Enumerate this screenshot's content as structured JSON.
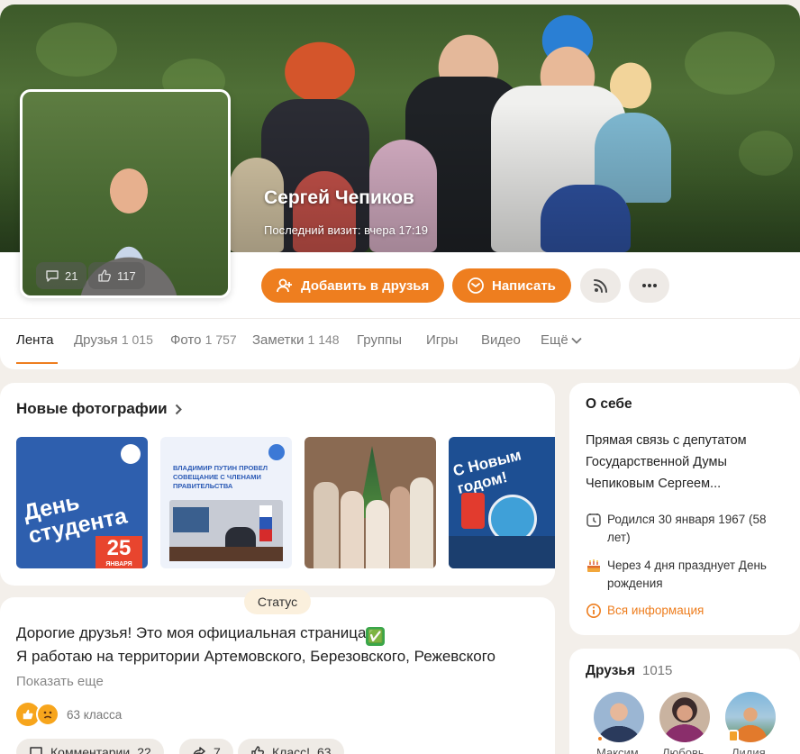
{
  "profile": {
    "name": "Сергей Чепиков",
    "last_visit": "Последний визит: вчера 17:19",
    "avatar_comments": "21",
    "avatar_likes": "117",
    "add_friend_label": "Добавить в друзья",
    "write_label": "Написать"
  },
  "tabs": [
    {
      "label": "Лента",
      "count": ""
    },
    {
      "label": "Друзья",
      "count": "1 015"
    },
    {
      "label": "Фото",
      "count": "1 757"
    },
    {
      "label": "Заметки",
      "count": "1 148"
    },
    {
      "label": "Группы",
      "count": ""
    },
    {
      "label": "Игры",
      "count": ""
    },
    {
      "label": "Видео",
      "count": ""
    },
    {
      "label": "Ещё",
      "count": ""
    }
  ],
  "photos": {
    "title": "Новые фотографии",
    "items": [
      {
        "line1": "День",
        "line2": "студента",
        "num": "25",
        "sub": "ЯНВАРЯ"
      },
      {
        "headline": "ВЛАДИМИР ПУТИН ПРОВЕЛ СОВЕЩАНИЕ С ЧЛЕНАМИ ПРАВИТЕЛЬСТВА"
      },
      {},
      {
        "greeting": "С Новым годом!"
      }
    ]
  },
  "about": {
    "title": "О себе",
    "text_lines": [
      "Прямая связь с депутатом",
      "Государственной Думы",
      "Чепиковым Сергеем..."
    ],
    "born_line1": "Родился 30 января 1967 (58",
    "born_line2": "лет)",
    "bday_line1": "Через 4 дня празднует День",
    "bday_line2": "рождения",
    "all_info": "Вся информация"
  },
  "post": {
    "status_label": "Статус",
    "line1": "Дорогие друзья! Это моя официальная страница",
    "line1_emoji": "✅",
    "line2": "Я работаю на территории Артемовского, Березовского, Режевского",
    "show_more": "Показать еще",
    "reactions": "63 класса",
    "comments_label": "Комментарии",
    "comments_count": "22",
    "shares_count": "7",
    "likes_label": "Класс!",
    "likes_count": "63"
  },
  "friends": {
    "title": "Друзья",
    "count": "1015",
    "names": [
      "Максим",
      "Любовь",
      "Лидия"
    ]
  },
  "colors": {
    "accent": "#ee7e1f",
    "background": "#f3efea"
  }
}
